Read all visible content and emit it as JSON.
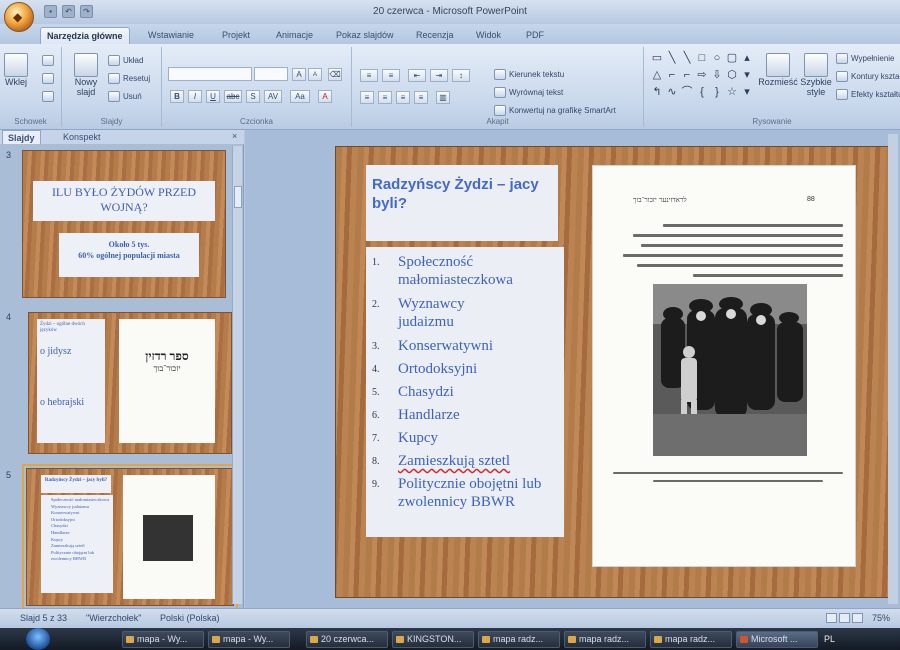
{
  "window": {
    "title": "20 czerwca - Microsoft PowerPoint"
  },
  "ribbon_tabs": [
    "Narzędzia główne",
    "Wstawianie",
    "Projekt",
    "Animacje",
    "Pokaz slajdów",
    "Recenzja",
    "Widok",
    "PDF"
  ],
  "ribbon": {
    "clipboard": {
      "paste": "Wklej",
      "label": "Schowek"
    },
    "slides": {
      "new_slide": "Nowy slajd",
      "layout": "Układ",
      "reset": "Resetuj",
      "delete": "Usuń",
      "label": "Slajdy"
    },
    "font": {
      "label": "Czcionka",
      "bold": "B",
      "italic": "I",
      "underline": "U",
      "strike": "abc",
      "shadow": "S",
      "spacing": "AV",
      "case": "Aa",
      "color": "A",
      "grow": "A",
      "shrink": "A"
    },
    "paragraph": {
      "direction": "Kierunek tekstu",
      "align": "Wyrównaj tekst",
      "smartart": "Konwertuj na grafikę SmartArt",
      "label": "Akapit"
    },
    "drawing": {
      "arrange": "Rozmieść",
      "quick_styles": "Szybkie style",
      "fill": "Wypełnienie",
      "outline": "Kontury kształtu",
      "effects": "Efekty kształtu",
      "label": "Rysowanie"
    }
  },
  "pane": {
    "tabs": [
      "Slajdy",
      "Konspekt"
    ],
    "close": "×",
    "thumbnails": [
      {
        "number": "3",
        "title": "ILU BYŁO ŻYDÓW PRZED WOJNĄ?",
        "line1": "Około 5 tys.",
        "line2": "60% ogólnej populacji miasta"
      },
      {
        "number": "4",
        "caption": "Żydzi – ogólne dwóch języków",
        "lang1": "o jidysz",
        "lang2": "o hebrajski",
        "book_title": "ספר רדזין",
        "book_subtitle": "יזכור־בוך"
      },
      {
        "number": "5",
        "title": "Radzyńscy Żydzi – jacy byli?"
      }
    ]
  },
  "slide": {
    "title": "Radzyńscy Żydzi – jacy byli?",
    "items": [
      {
        "num": "1.",
        "text": "Społeczność małomiasteczkowa"
      },
      {
        "num": "2.",
        "text": "Wyznawcy judaizmu"
      },
      {
        "num": "3.",
        "text": "Konserwatywni"
      },
      {
        "num": "4.",
        "text": "Ortodoksyjni"
      },
      {
        "num": "5.",
        "text": "Chasydzi"
      },
      {
        "num": "6.",
        "text": "Handlarze"
      },
      {
        "num": "7.",
        "text": "Kupcy"
      },
      {
        "num": "8.",
        "text": "Zamieszkują sztetl"
      },
      {
        "num": "9.",
        "text": "Politycznie obojętni lub zwolennicy BBWR"
      }
    ],
    "page_header": "לראדזינער יזכור־בוך",
    "page_number": "88"
  },
  "status": {
    "slide_of": "Slajd 5 z 33",
    "theme": "\"Wierzchołek\"",
    "language": "Polski (Polska)",
    "zoom": "75%"
  },
  "taskbar": {
    "items": [
      "mapa - Wy...",
      "mapa - Wy...",
      "20 czerwca...",
      "KINGSTON...",
      "mapa radz...",
      "mapa radz...",
      "mapa radz...",
      "Microsoft ..."
    ],
    "lang": "PL"
  }
}
